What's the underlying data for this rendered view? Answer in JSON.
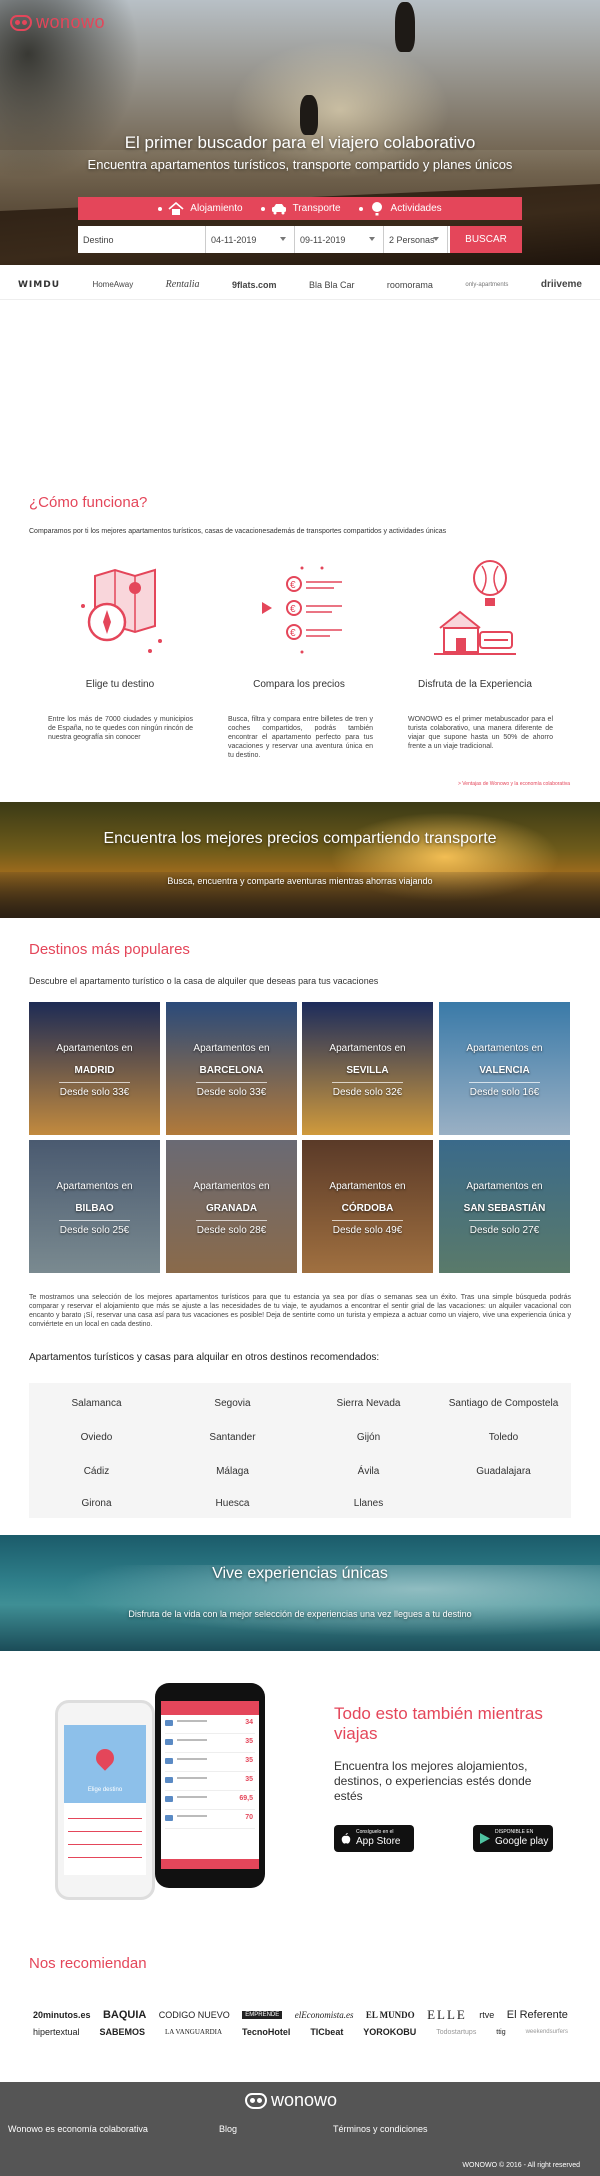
{
  "brand": {
    "name": "wonowo",
    "accent": "#e4465a"
  },
  "hero": {
    "title": "El primer buscador para el viajero colaborativo",
    "subtitle": "Encuentra apartamentos turísticos, transporte compartido y planes únicos"
  },
  "search": {
    "tabs": [
      {
        "label": "Alojamiento",
        "icon": "house-icon"
      },
      {
        "label": "Transporte",
        "icon": "car-icon"
      },
      {
        "label": "Actividades",
        "icon": "balloon-icon"
      }
    ],
    "destination_placeholder": "Destino",
    "checkin": "04-11-2019",
    "checkout": "09-11-2019",
    "persons": "2 Personas",
    "button": "BUSCAR"
  },
  "partners": [
    "WIMDU",
    "HomeAway",
    "Rentalia",
    "9flats.com",
    "Bla Bla Car",
    "roomorama",
    "only-apartments",
    "driiveme"
  ],
  "how": {
    "title": "¿Cómo funciona?",
    "description": "Comparamos por ti los mejores apartamentos turísticos, casas de vacacionesademás de transportes compartidos y actividades únicas",
    "steps": [
      {
        "title": "Elige tu destino",
        "text": "Entre los más de 7000 ciudades y municipios de España, no te quedes con ningún rincón de nuestra geografía sin conocer",
        "icon": "map-compass-icon"
      },
      {
        "title": "Compara los precios",
        "text": "Busca, filtra y compara entre billetes de tren y coches compartidos, podrás también encontrar el apartamento perfecto para tus vacaciones y reservar una aventura única en tu destino.",
        "icon": "price-list-icon"
      },
      {
        "title": "Disfruta de la Experiencia",
        "text": "WONOWO es el primer metabuscador para el turista colaborativo, una manera diferente de viajar que supone hasta un 50% de ahorro frente a un viaje tradicional.",
        "icon": "house-balloon-icon"
      }
    ],
    "link": "> Ventajas de Wonowo y la economía colaborativa"
  },
  "transport_banner": {
    "title": "Encuentra los mejores precios compartiendo transporte",
    "subtitle": "Busca, encuentra y comparte aventuras mientras ahorras viajando"
  },
  "destinations": {
    "title": "Destinos más populares",
    "description": "Descubre el apartamento turístico o la casa de alquiler que deseas para tus vacaciones",
    "prefix": "Apartamentos en",
    "cities": [
      {
        "name": "MADRID",
        "price": "Desde solo 33€",
        "color1": "#1d2b55",
        "color2": "#c28a3e"
      },
      {
        "name": "BARCELONA",
        "price": "Desde solo 33€",
        "color1": "#2a4a7a",
        "color2": "#b27a3a"
      },
      {
        "name": "SEVILLA",
        "price": "Desde solo 32€",
        "color1": "#1c2c5c",
        "color2": "#d09a3c"
      },
      {
        "name": "VALENCIA",
        "price": "Desde solo 16€",
        "color1": "#3a7aa8",
        "color2": "#9ab0c4"
      },
      {
        "name": "BILBAO",
        "price": "Desde solo 25€",
        "color1": "#4a5a70",
        "color2": "#7a8a90"
      },
      {
        "name": "GRANADA",
        "price": "Desde solo 28€",
        "color1": "#6a6a74",
        "color2": "#8a6a4a"
      },
      {
        "name": "CÓRDOBA",
        "price": "Desde solo 49€",
        "color1": "#5a3a28",
        "color2": "#a07040"
      },
      {
        "name": "SAN SEBASTIÁN",
        "price": "Desde solo 27€",
        "color1": "#3a6a8a",
        "color2": "#5a7a6a"
      }
    ],
    "seo_text": "Te mostramos una selección de los mejores apartamentos turísticos para que tu estancia ya sea por días o semanas sea un éxito. Tras una simple búsqueda podrás comparar y reservar el alojamiento que más se ajuste a las necesidades de tu viaje, te ayudamos a encontrar el sentir grial de las vacaciones: un alquiler vacacional con encanto y barato ¡Sí, reservar una casa así para tus vacaciones es posible! Deja de sentirte como un turista y empieza a actuar como un viajero, vive una experiencia única y conviértete en un local en cada destino."
  },
  "other": {
    "title": "Apartamentos turísticos y casas para alquilar en otros destinos recomendados:",
    "rows": [
      [
        "Salamanca",
        "Segovia",
        "Sierra Nevada",
        "Santiago de Compostela"
      ],
      [
        "Oviedo",
        "Santander",
        "Gijón",
        "Toledo"
      ],
      [
        "Cádiz",
        "Málaga",
        "Ávila",
        "Guadalajara"
      ],
      [
        "Girona",
        "Huesca",
        "Llanes",
        ""
      ]
    ]
  },
  "experience_banner": {
    "title": "Vive experiencias únicas",
    "subtitle": "Disfruta de la vida con la mejor selección de experiencias una vez llegues a tu destino"
  },
  "app": {
    "title": "Todo esto también mientras viajas",
    "subtitle": "Encuentra los mejores alojamientos, destinos, o experiencias estés donde estés",
    "appstore_top": "Consíguelo en el",
    "appstore": "App Store",
    "googleplay_top": "DISPONIBLE EN",
    "googleplay": "Google play",
    "phone_caption": "Elige destino",
    "prices": [
      "34",
      "35",
      "35",
      "35",
      "69,5",
      "70"
    ]
  },
  "recommend": {
    "title": "Nos recomiendan",
    "row1": [
      "20minutos.es",
      "BAQUIA",
      "CODIGO NUEVO",
      "EMPRENDE",
      "elEconomista.es",
      "EL MUNDO",
      "ELLE",
      "rtve",
      "El Referente"
    ],
    "row2": [
      "hipertextual",
      "SABEMOS",
      "LA VANGUARDIA",
      "TecnoHotel",
      "TICbeat",
      "YOROKOBU",
      "Todostartups",
      "ttig",
      "weekendsurfers"
    ]
  },
  "footer": {
    "links": [
      "Wonowo es economía colaborativa",
      "Blog",
      "Términos y condiciones"
    ],
    "copyright": "WONOWO © 2016 - All right reserved"
  }
}
